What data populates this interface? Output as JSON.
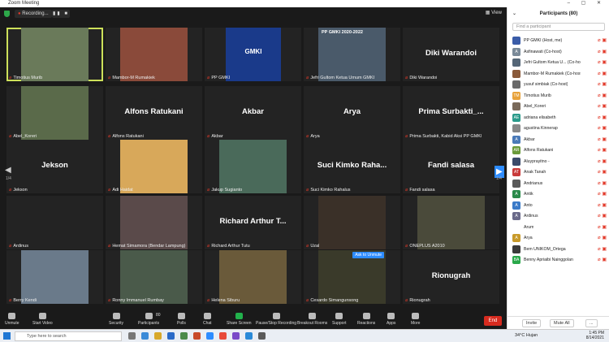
{
  "window": {
    "title": "Zoom Meeting",
    "view_label": "View"
  },
  "topbar": {
    "recording_label": "Recording...",
    "pause_stop": "▮▮ ■"
  },
  "tiles": [
    {
      "name": "Timotius Murib",
      "highlight": true,
      "type": "video"
    },
    {
      "name": "Mambor-M Rumakiek",
      "type": "video"
    },
    {
      "name": "PP GMKI",
      "type": "logo",
      "logo_text": "GMKI"
    },
    {
      "name": "Jefri Gultom Ketua Umum GMKI",
      "type": "video",
      "overlay": "PP GMKI 2020-2022"
    },
    {
      "name": "Diki Warandoi",
      "type": "name",
      "big": "Diki Warandoi"
    },
    {
      "name": "Abel_Koreri",
      "type": "video"
    },
    {
      "name": "Alfons Ratukani",
      "type": "name",
      "big": "Alfons Ratukani"
    },
    {
      "name": "Akbar",
      "type": "name",
      "big": "Akbar"
    },
    {
      "name": "Arya",
      "type": "name",
      "big": "Arya"
    },
    {
      "name": "Prima Surbakti, Kabid Aksi PP GMKI",
      "type": "name",
      "big": "Prima Surbakti_..."
    },
    {
      "name": "Jekson",
      "type": "name",
      "big": "Jekson"
    },
    {
      "name": "Adi Haidat",
      "type": "video"
    },
    {
      "name": "Jakup Sugianto",
      "type": "video"
    },
    {
      "name": "Suci Kimko Rahalus",
      "type": "name",
      "big": "Suci Kimko Raha..."
    },
    {
      "name": "Fandi salasa",
      "type": "name",
      "big": "Fandi salasa"
    },
    {
      "name": "Ardinus",
      "type": "empty"
    },
    {
      "name": "Hemat Simamora (Bendar Lampung)",
      "type": "video"
    },
    {
      "name": "Richard Arthur Tutu",
      "type": "name",
      "big": "Richard Arthur T..."
    },
    {
      "name": "Uzal",
      "type": "video"
    },
    {
      "name": "ONEPLUS A2010",
      "type": "video"
    },
    {
      "name": "Berry Kendi",
      "type": "video"
    },
    {
      "name": "Ronny Immanuel Rumbay",
      "type": "video"
    },
    {
      "name": "Helena Siburu",
      "type": "video"
    },
    {
      "name": "Cesardo Simangunsong",
      "type": "video",
      "ask": "Ask to Unmute"
    },
    {
      "name": "Rionugrah",
      "type": "name",
      "big": "Rionugrah"
    }
  ],
  "pager": {
    "left": "1/4",
    "right": "1/4"
  },
  "toolbar": {
    "items": [
      {
        "label": "Unmute"
      },
      {
        "label": "Start Video"
      },
      {
        "label": "Security"
      },
      {
        "label": "Participants",
        "count": "80"
      },
      {
        "label": "Polls"
      },
      {
        "label": "Chat"
      },
      {
        "label": "Share Screen"
      },
      {
        "label": "Pause/Stop Recording"
      },
      {
        "label": "Breakout Rooms"
      },
      {
        "label": "Support"
      },
      {
        "label": "Reactions"
      },
      {
        "label": "Apps"
      },
      {
        "label": "More"
      }
    ],
    "end_label": "End"
  },
  "panel": {
    "title": "Participants (80)",
    "search_placeholder": "Find a participant",
    "invite": "Invite",
    "mute_all": "Mute All",
    "more": "...",
    "participants": [
      {
        "name": "PP GMKI (Host, me)",
        "initials": "",
        "color": "#3a5ca8"
      },
      {
        "name": "Asfinawati (Co-host)",
        "initials": "A",
        "color": "#7a8a99"
      },
      {
        "name": "Jefri Gultom Ketua U... (Co-host)",
        "initials": "",
        "color": "#556677"
      },
      {
        "name": "Mambor-M Rumakiek (Co-host)",
        "initials": "",
        "color": "#8a5a3a"
      },
      {
        "name": "yusuf simbiak (Co-host)",
        "initials": "",
        "color": "#6a6a6a"
      },
      {
        "name": "Timotius Murib",
        "initials": "TM",
        "color": "#e8a23a"
      },
      {
        "name": "Abel_Koreri",
        "initials": "",
        "color": "#7a6a5a"
      },
      {
        "name": "adriana elisabeth",
        "initials": "AE",
        "color": "#2a9a8a"
      },
      {
        "name": "agustina Kinnerap",
        "initials": "",
        "color": "#888"
      },
      {
        "name": "Akbar",
        "initials": "A",
        "color": "#4a7ab8"
      },
      {
        "name": "Alfons Ratukani",
        "initials": "AR",
        "color": "#6a9a3a"
      },
      {
        "name": "Aluyprayitno -",
        "initials": "",
        "color": "#3a4a6a"
      },
      {
        "name": "Anak Tanah",
        "initials": "AT",
        "color": "#c83a3a"
      },
      {
        "name": "Andrianus",
        "initials": "",
        "color": "#5a5a5a"
      },
      {
        "name": "Antik",
        "initials": "A",
        "color": "#2a8a4a"
      },
      {
        "name": "Anto",
        "initials": "A",
        "color": "#3a7ac8"
      },
      {
        "name": "Ardinus",
        "initials": "A",
        "color": "#6a6a8a"
      },
      {
        "name": "Arum",
        "initials": "",
        "color": "#fff"
      },
      {
        "name": "Arya",
        "initials": "A",
        "color": "#c89a2a"
      },
      {
        "name": "Bem UNIKOM_Ortega",
        "initials": "",
        "color": "#3a3a3a"
      },
      {
        "name": "Benny Apriaibi Nainggolan",
        "initials": "BA",
        "color": "#2aa84a"
      }
    ]
  },
  "taskbar": {
    "search_placeholder": "Type here to search",
    "weather": "34°C Hujan",
    "time": "1:45 PM",
    "date": "8/14/2021"
  },
  "colors": {
    "accent": "#2d8cff",
    "highlight": "#cde05a",
    "muted": "#e23a2a",
    "end": "#d72b1f"
  }
}
